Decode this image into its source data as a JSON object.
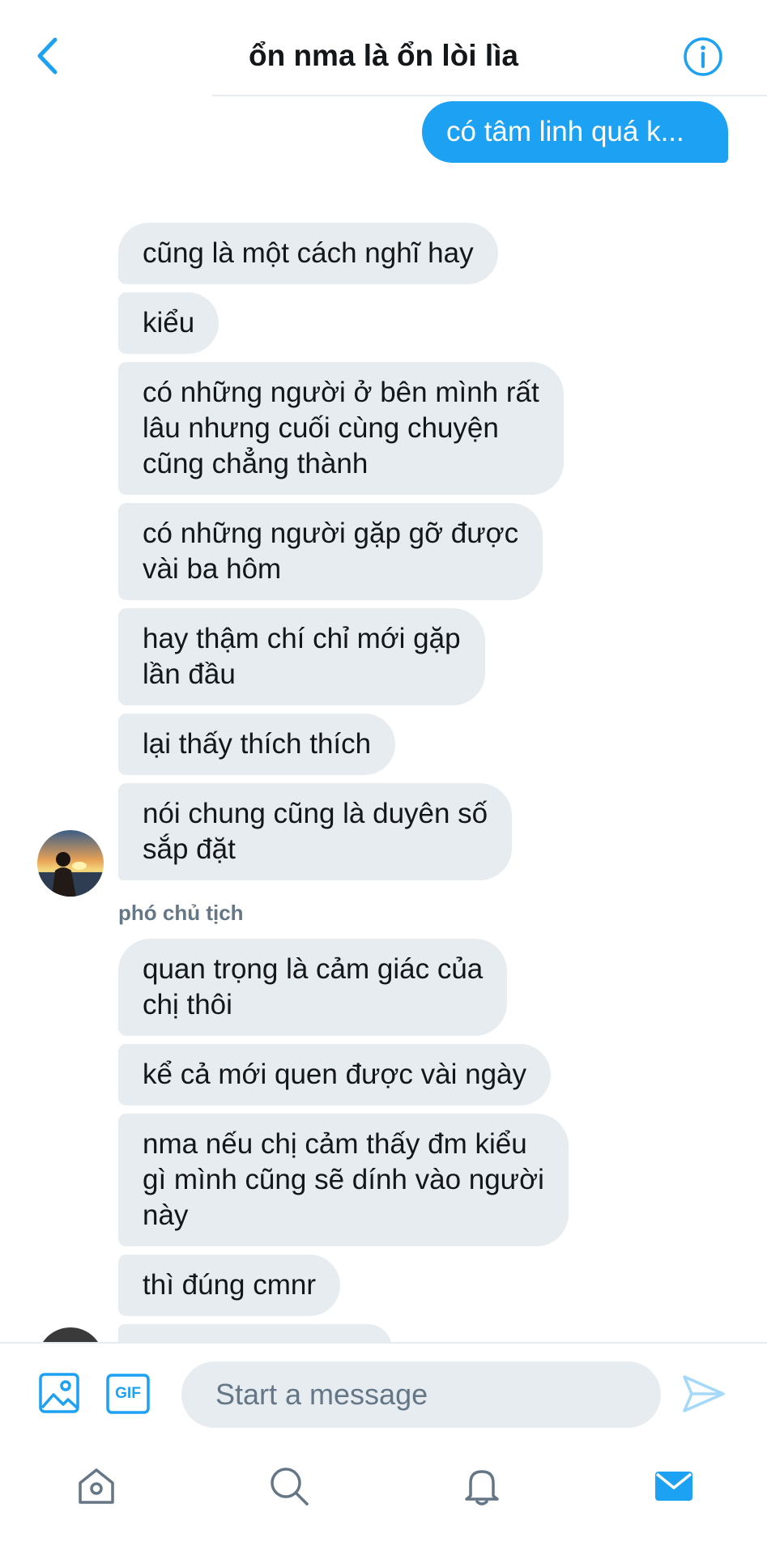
{
  "header": {
    "title": "ổn nma là ổn lòi lìa",
    "back_icon": "chevron-left-icon",
    "info_icon": "info-icon"
  },
  "messages": {
    "outgoing": [
      {
        "text": "có tâm linh quá k..."
      }
    ],
    "group1": [
      {
        "lines": [
          "cũng là một cách nghĩ hay"
        ]
      },
      {
        "lines": [
          "kiểu"
        ]
      },
      {
        "lines": [
          "có những người ở bên mình rất",
          "lâu nhưng cuối cùng chuyện",
          "cũng chẳng thành"
        ]
      },
      {
        "lines": [
          "có những người gặp gỡ được",
          "vài ba hôm"
        ]
      },
      {
        "lines": [
          "hay thậm chí chỉ mới gặp",
          "lần đầu"
        ]
      },
      {
        "lines": [
          "lại thấy thích thích"
        ]
      },
      {
        "lines": [
          "nói chung cũng là duyên số",
          "sắp đặt"
        ]
      }
    ],
    "sender_name": "phó chủ tịch",
    "group2": [
      {
        "lines": [
          "quan trọng là cảm giác của",
          "chị thôi"
        ]
      },
      {
        "lines": [
          "kể cả mới quen được vài ngày"
        ]
      },
      {
        "lines": [
          "nma nếu chị cảm thấy đm kiểu",
          "gì mình cũng sẽ dính vào người",
          "này"
        ]
      },
      {
        "lines": [
          "thì đúng cmnr"
        ]
      }
    ]
  },
  "composer": {
    "placeholder": "Start a message",
    "image_icon": "image-icon",
    "gif_label": "GIF",
    "send_icon": "send-icon"
  },
  "tabs": [
    {
      "name": "home",
      "icon": "home-icon"
    },
    {
      "name": "search",
      "icon": "search-icon"
    },
    {
      "name": "notifications",
      "icon": "bell-icon"
    },
    {
      "name": "messages",
      "icon": "mail-icon"
    }
  ],
  "colors": {
    "accent": "#1da1f2",
    "incoming_bubble": "#e6ecf0",
    "muted_text": "#657786"
  }
}
